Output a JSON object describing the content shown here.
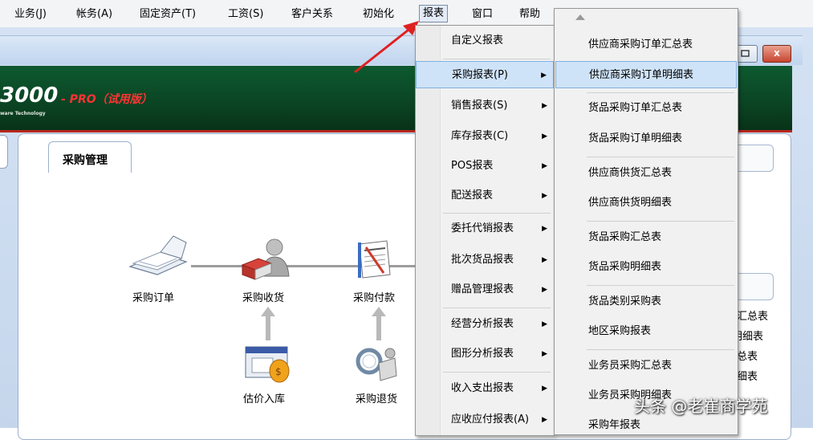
{
  "menubar": {
    "items": [
      {
        "label": "业务(J)"
      },
      {
        "label": "帐务(A)"
      },
      {
        "label": "固定资产(T)"
      },
      {
        "label": "工资(S)"
      },
      {
        "label": "客户关系"
      },
      {
        "label": "初始化"
      },
      {
        "label": "报表"
      },
      {
        "label": "窗口"
      },
      {
        "label": "帮助"
      }
    ]
  },
  "window": {
    "close_label": "x",
    "logo_number": "3000",
    "logo_pro": "- PRO（试用版）",
    "logo_sub": "ware Technology"
  },
  "content": {
    "tab_label": "采购管理",
    "right_fragments": [
      "汇总表",
      "明细表",
      "总表",
      "细表"
    ]
  },
  "workflow": {
    "nodes": [
      {
        "label": "采购订单",
        "icon": "notebook-icon"
      },
      {
        "label": "采购收货",
        "icon": "person-package-icon"
      },
      {
        "label": "采购付款",
        "icon": "txt-document-icon"
      },
      {
        "label": "估价入库",
        "icon": "money-bag-icon"
      },
      {
        "label": "采购退货",
        "icon": "return-goods-icon"
      }
    ]
  },
  "report_menu": {
    "items": [
      {
        "label": "自定义报表",
        "has_submenu": false
      },
      {
        "label": "采购报表(P)",
        "has_submenu": true,
        "highlighted": true
      },
      {
        "label": "销售报表(S)",
        "has_submenu": true
      },
      {
        "label": "库存报表(C)",
        "has_submenu": true
      },
      {
        "label": "POS报表",
        "has_submenu": true
      },
      {
        "label": "配送报表",
        "has_submenu": true
      },
      {
        "label": "委托代销报表",
        "has_submenu": true
      },
      {
        "label": "批次货品报表",
        "has_submenu": true
      },
      {
        "label": "赠品管理报表",
        "has_submenu": true
      },
      {
        "label": "经营分析报表",
        "has_submenu": true
      },
      {
        "label": "图形分析报表",
        "has_submenu": true
      },
      {
        "label": "收入支出报表",
        "has_submenu": true
      },
      {
        "label": "应收应付报表(A)",
        "has_submenu": true
      }
    ]
  },
  "purchase_submenu": {
    "items": [
      {
        "label": "供应商采购订单汇总表"
      },
      {
        "label": "供应商采购订单明细表",
        "highlighted": true
      },
      {
        "label": "货品采购订单汇总表"
      },
      {
        "label": "货品采购订单明细表"
      },
      {
        "label": "供应商供货汇总表"
      },
      {
        "label": "供应商供货明细表"
      },
      {
        "label": "货品采购汇总表"
      },
      {
        "label": "货品采购明细表"
      },
      {
        "label": "货品类别采购表"
      },
      {
        "label": "地区采购报表"
      },
      {
        "label": "业务员采购汇总表"
      },
      {
        "label": "业务员采购明细表"
      },
      {
        "label": "采购年报表"
      }
    ]
  },
  "watermark": "头条 @老崔商学苑",
  "colors": {
    "banner": "#0b4423",
    "banner_border": "#b8271c",
    "menu_highlight": "#cfe3f8",
    "pro_text": "#ff3333"
  }
}
